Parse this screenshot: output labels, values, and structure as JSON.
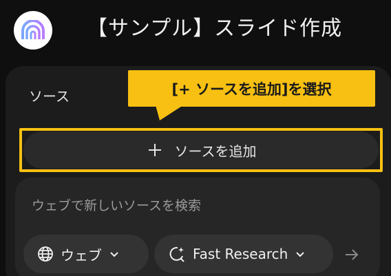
{
  "header": {
    "title": "【サンプル】スライド作成",
    "logo_icon": "notebook-logo-icon"
  },
  "sources": {
    "title": "ソース",
    "add_button_label": "ソースを追加",
    "add_icon": "plus-icon",
    "callout_text": "[+ ソースを追加]を選択",
    "highlight_color": "#f7c012"
  },
  "search": {
    "placeholder": "ウェブで新しいソースを検索",
    "source_type_chip": {
      "label": "ウェブ",
      "icon": "globe-icon"
    },
    "research_chip": {
      "label": "Fast Research",
      "icon": "research-sparkle-icon"
    },
    "submit_icon": "arrow-right-icon"
  }
}
